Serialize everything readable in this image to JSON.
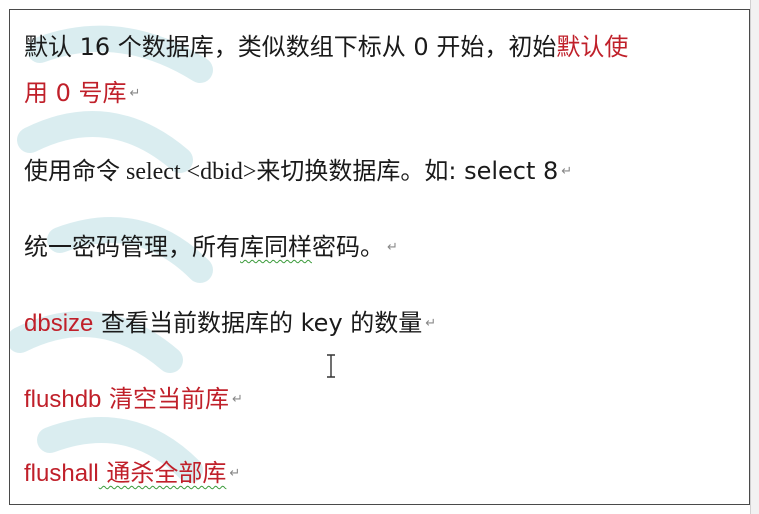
{
  "doc": {
    "line1": {
      "text": "默认 16 个数据库，类似数组下标从 0 开始，初始",
      "red": "默认使"
    },
    "line2": {
      "red": "用 0 号库"
    },
    "line3": {
      "part1": "使用命令 select   <dbid>",
      "part2": "来切换数据库。如: select 8"
    },
    "line4": {
      "part1": "统一密码管理，所有",
      "squiggle": "库同样",
      "part2": "密码。"
    },
    "line5": {
      "cmd": "dbsize",
      "text": " 查看当前数据库的 key 的数量"
    },
    "line6": {
      "cmd": "flushdb",
      "text": " 清空当前库"
    },
    "line7": {
      "cmd": "flushall",
      "text": " 通杀全部库"
    },
    "paragraph_mark": "↵"
  },
  "colors": {
    "accent_red": "#c0202a",
    "text": "#1a1a1a",
    "watermark": "#3aa0b0"
  },
  "icons": {
    "cursor": "text-cursor-icon",
    "watermark": "watermark-logo"
  }
}
